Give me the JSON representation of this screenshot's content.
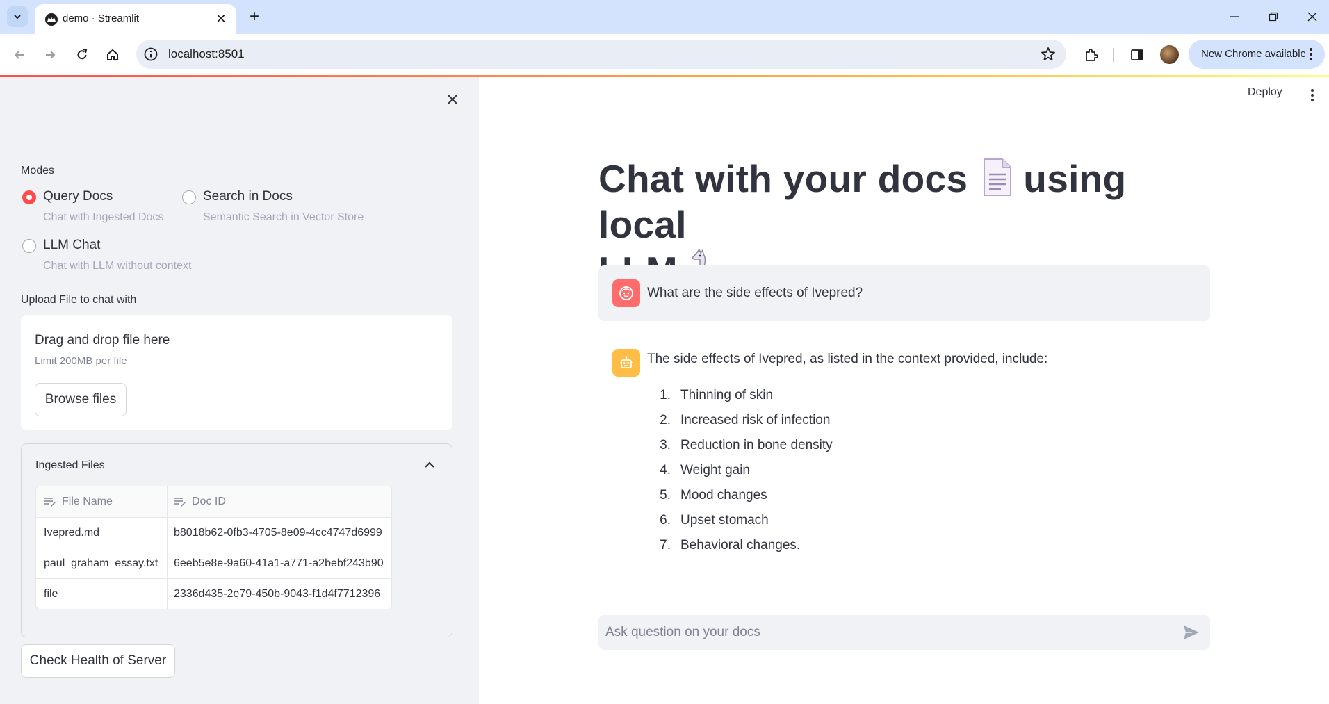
{
  "browser": {
    "tab_title": "demo · Streamlit",
    "url": "localhost:8501",
    "update_label": "New Chrome available"
  },
  "sidebar": {
    "modes_label": "Modes",
    "modes": [
      {
        "label": "Query Docs",
        "caption": "Chat with Ingested Docs",
        "selected": true
      },
      {
        "label": "Search in Docs",
        "caption": "Semantic Search in Vector Store",
        "selected": false
      },
      {
        "label": "LLM Chat",
        "caption": "Chat with LLM without context",
        "selected": false
      }
    ],
    "upload_label": "Upload File to chat with",
    "uploader": {
      "drag_text": "Drag and drop file here",
      "limit_text": "Limit 200MB per file",
      "browse_label": "Browse files"
    },
    "ingested": {
      "title": "Ingested Files",
      "columns": [
        "File Name",
        "Doc ID"
      ],
      "rows": [
        [
          "Ivepred.md",
          "b8018b62-0fb3-4705-8e09-4cc4747d6999"
        ],
        [
          "paul_graham_essay.txt",
          "6eeb5e8e-9a60-41a1-a771-a2bebf243b90"
        ],
        [
          "file",
          "2336d435-2e79-450b-9043-f1d4f7712396"
        ]
      ]
    },
    "health_button": "Check Health of Server"
  },
  "main": {
    "deploy_label": "Deploy",
    "title_part1": "Chat with your docs",
    "title_part2": "using local",
    "title_part3": "LLM",
    "user_message": "What are the side effects of Ivepred?",
    "assistant_intro": "The side effects of Ivepred, as listed in the context provided, include:",
    "assistant_list": [
      "Thinning of skin",
      "Increased risk of infection",
      "Reduction in bone density",
      "Weight gain",
      "Mood changes",
      "Upset stomach",
      "Behavioral changes."
    ],
    "chat_placeholder": "Ask question on your docs"
  },
  "colors": {
    "accent": "#ff4b4b",
    "assistant_avatar": "#ffbd45",
    "sidebar_bg": "#f0f2f6"
  }
}
